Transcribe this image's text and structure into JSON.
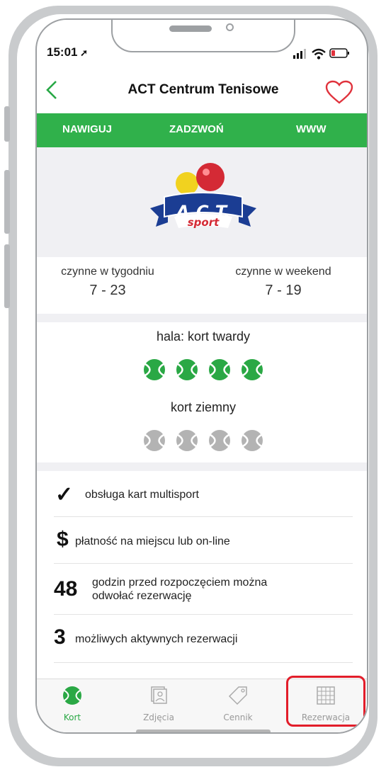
{
  "status_bar": {
    "time": "15:01"
  },
  "header": {
    "title": "ACT Centrum Tenisowe"
  },
  "actions": {
    "navigate": "NAWIGUJ",
    "call": "ZADZWOŃ",
    "www": "WWW"
  },
  "logo": {
    "line1": "A.C.T.",
    "line2": "sport"
  },
  "hours": {
    "weekday_label": "czynne w tygodniu",
    "weekday_value": "7 - 23",
    "weekend_label": "czynne w weekend",
    "weekend_value": "7 - 19"
  },
  "courts": [
    {
      "name": "hala: kort twardy",
      "count": 4,
      "color": "#2aa845"
    },
    {
      "name": "kort ziemny",
      "count": 4,
      "color": "#b3b3b3"
    }
  ],
  "features": [
    {
      "icon": "✓",
      "text": "obsługa kart multisport"
    },
    {
      "icon": "$",
      "text": "płatność na miejscu lub on-line"
    },
    {
      "icon": "48",
      "text": "godzin przed rozpoczęciem można odwołać rezerwację"
    },
    {
      "icon": "3",
      "text": "możliwych aktywnych rezerwacji"
    }
  ],
  "tabs": {
    "kort": "Kort",
    "zdjecia": "Zdjęcia",
    "cennik": "Cennik",
    "rezerwacja": "Rezerwacja"
  },
  "colors": {
    "accent": "#30b14b",
    "highlight": "#e21d2a",
    "heart": "#e0323c"
  }
}
